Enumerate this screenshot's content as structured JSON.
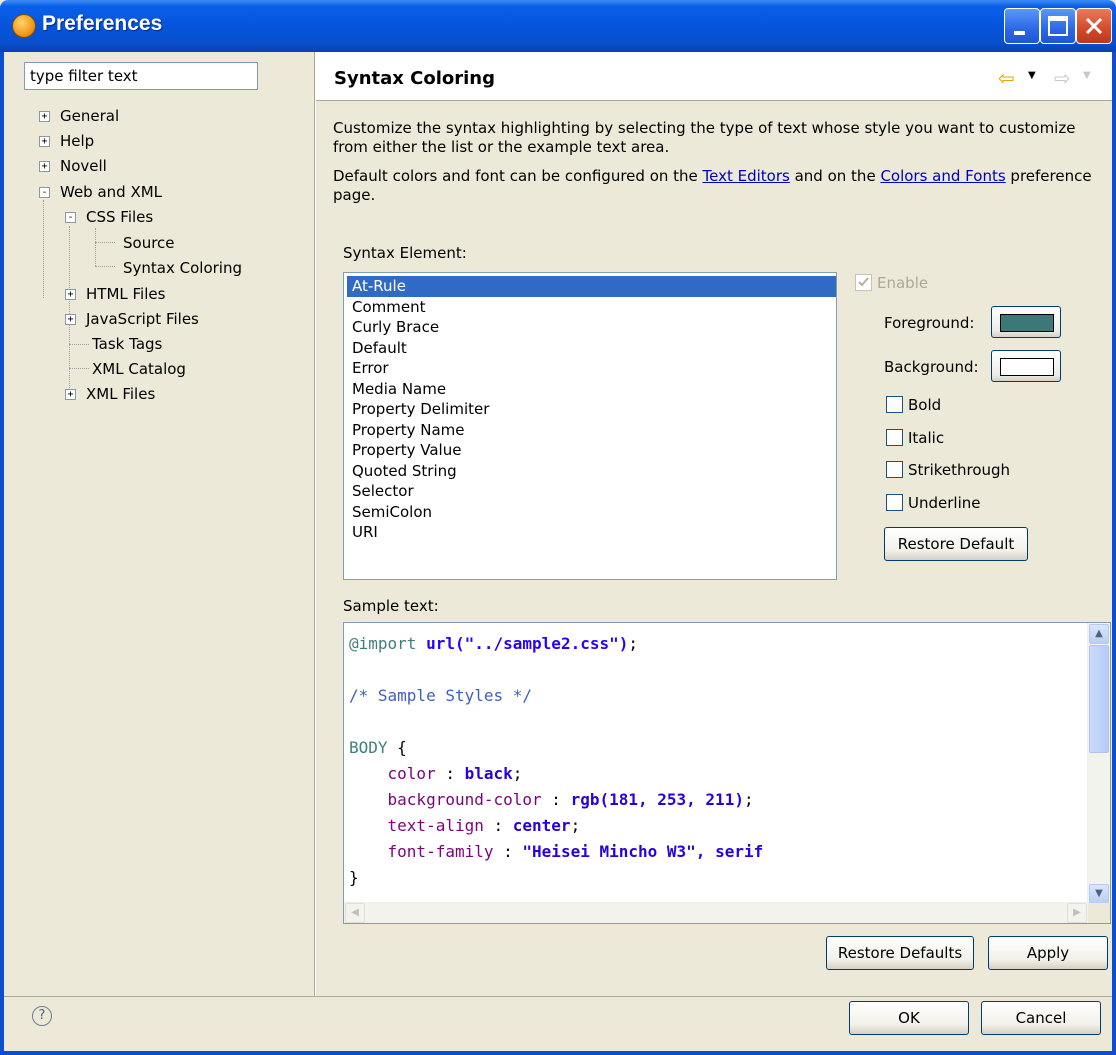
{
  "window": {
    "title": "Preferences",
    "minimize_icon": "minimize-icon",
    "maximize_icon": "maximize-icon",
    "close_icon": "close-icon"
  },
  "sidebar": {
    "filter_value": "type filter text",
    "tree": [
      {
        "label": "General",
        "expander": "+"
      },
      {
        "label": "Help",
        "expander": "+"
      },
      {
        "label": "Novell",
        "expander": "+"
      },
      {
        "label": "Web and XML",
        "expander": "-"
      },
      {
        "label": "CSS Files",
        "expander": "-"
      },
      {
        "label": "Source"
      },
      {
        "label": "Syntax Coloring",
        "selected": true
      },
      {
        "label": "HTML Files",
        "expander": "+"
      },
      {
        "label": "JavaScript Files",
        "expander": "+"
      },
      {
        "label": "Task Tags"
      },
      {
        "label": "XML Catalog"
      },
      {
        "label": "XML Files",
        "expander": "+"
      }
    ]
  },
  "page": {
    "title": "Syntax Coloring",
    "description1": "Customize the syntax highlighting by selecting the type of text whose style you want to customize from either the list or the example text area.",
    "description2_pre": "Default colors and font can be configured on the ",
    "link_text_editors": "Text Editors",
    "description2_mid": " and on the ",
    "link_colors_fonts": "Colors and Fonts",
    "description2_post": " preference page.",
    "syntax_element_label": "Syntax Element:",
    "syntax_elements": [
      "At-Rule",
      "Comment",
      "Curly Brace",
      "Default",
      "Error",
      "Media Name",
      "Property Delimiter",
      "Property Name",
      "Property Value",
      "Quoted String",
      "Selector",
      "SemiColon",
      "URI"
    ],
    "selected_element": "At-Rule",
    "enable_label": "Enable",
    "foreground_label": "Foreground:",
    "background_label": "Background:",
    "foreground_color": "#3c7878",
    "background_color": "#ffffff",
    "bold_label": "Bold",
    "italic_label": "Italic",
    "strikethrough_label": "Strikethrough",
    "underline_label": "Underline",
    "restore_default_label": "Restore Default",
    "sample_text_label": "Sample text:",
    "restore_defaults_label": "Restore Defaults",
    "apply_label": "Apply"
  },
  "sample_code": {
    "line1_atrule": "@import",
    "line1_uri": "url(\"../sample2.css\")",
    "line1_semi": ";",
    "line3_comment": "/* Sample Styles */",
    "line5_selector": "BODY",
    "line5_brace": " {",
    "props": [
      {
        "name": "color",
        "value": "black"
      },
      {
        "name": "background-color",
        "value": "rgb(181, 253, 211)"
      },
      {
        "name": "text-align",
        "value": "center"
      },
      {
        "name": "font-family",
        "value": "\"Heisei Mincho W3\", serif"
      }
    ],
    "line10_brace": "}"
  },
  "footer": {
    "help_icon": "help-icon",
    "ok_label": "OK",
    "cancel_label": "Cancel"
  },
  "colors": {
    "titlebar": "#0553db",
    "selection": "#316ac5",
    "atrule": "#3f7f7f",
    "uri": "#2a00ff",
    "comment": "#3f5fbf",
    "selector": "#3f7f7f",
    "property_name": "#7f007f",
    "property_value": "#2a00e1"
  }
}
